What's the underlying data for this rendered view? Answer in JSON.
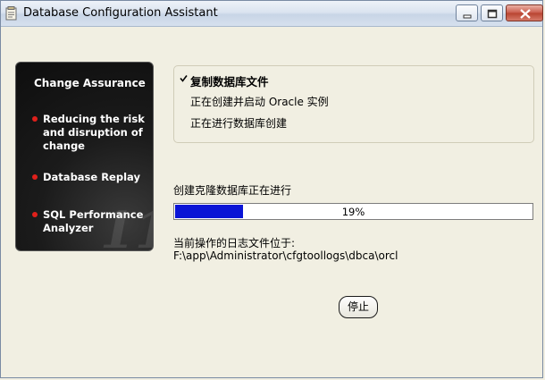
{
  "window": {
    "title": "Database Configuration Assistant"
  },
  "sidebar": {
    "header": "Change Assurance",
    "items": [
      {
        "label_lines": [
          "Reducing the risk",
          "and disruption of",
          "change"
        ]
      },
      {
        "label_lines": [
          "Database Replay"
        ]
      },
      {
        "label_lines": [
          "SQL Performance",
          "Analyzer"
        ]
      }
    ],
    "watermark": "11g"
  },
  "steps": [
    {
      "label": "复制数据库文件",
      "status": "completed"
    },
    {
      "label": "正在创建并启动 Oracle 实例",
      "status": "pending"
    },
    {
      "label": "正在进行数据库创建",
      "status": "pending"
    }
  ],
  "progress": {
    "label": "创建克隆数据库正在进行",
    "percent": 19,
    "percent_text": "19%",
    "fill_color": "#0a14d6"
  },
  "log": {
    "label": "当前操作的日志文件位于:",
    "path": "F:\\app\\Administrator\\cfgtoollogs\\dbca\\orcl"
  },
  "buttons": {
    "stop": "停止"
  }
}
